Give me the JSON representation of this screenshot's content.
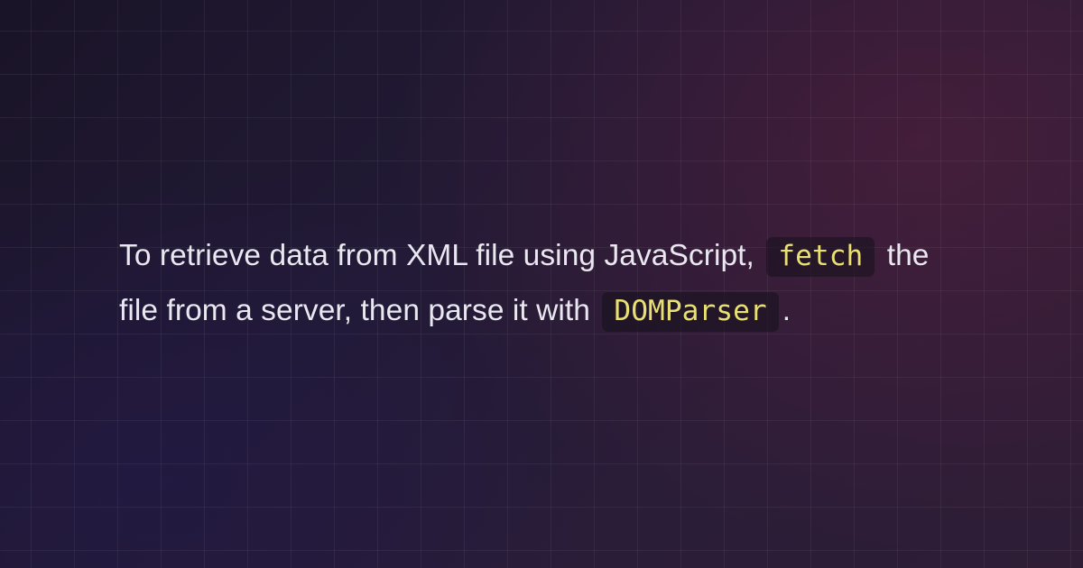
{
  "paragraph": {
    "part1": "To retrieve data from XML file using JavaScript, ",
    "code1": "fetch",
    "part2": " the file from a server, then parse it with ",
    "code2": "DOMParser",
    "part3": "."
  }
}
